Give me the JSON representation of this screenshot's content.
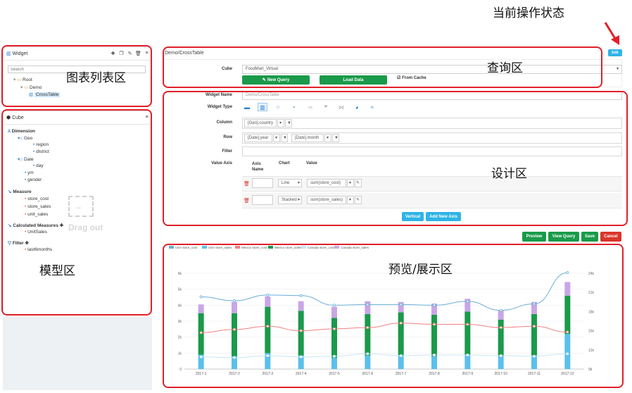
{
  "annotations": {
    "operation_status": "当前操作状态",
    "chart_list_area": "图表列表区",
    "query_area": "查询区",
    "design_area": "设计区",
    "model_area": "模型区",
    "preview_area": "预览/展示区"
  },
  "widget_panel": {
    "title": "Widget",
    "search_placeholder": "Search",
    "tree": [
      "Root",
      "Demo",
      "CrossTable"
    ]
  },
  "cube_panel": {
    "title": "Cube",
    "dimension_label": "Dimension",
    "geo": "Geo",
    "region": "region",
    "district": "district",
    "date": "Date",
    "day": "day",
    "ym": "ym",
    "gender": "gender",
    "measure_label": "Measure",
    "measures": [
      "store_cost",
      "store_sales",
      "unit_sales"
    ],
    "calculated_label": "Calculated Measures",
    "calculated": [
      "UnitSales"
    ],
    "filter_label": "Filter",
    "filters": [
      "last6months"
    ],
    "drag_hint": "Drag out"
  },
  "header": {
    "breadcrumb": "Demo/CrossTable",
    "edit_badge": "Edit"
  },
  "query": {
    "cube_label": "Cube",
    "cube_value": "FoodMart_Virtual",
    "new_query": "New Query",
    "load_data": "Load Data",
    "from_cache": "From Cache"
  },
  "design": {
    "widget_name_label": "Widget Name",
    "widget_name_value": "Demo/CrossTable",
    "widget_type_label": "Widget Type",
    "column_label": "Column",
    "column_value": "[Geo].country",
    "row_label": "Row",
    "row_value_1": "[Date].year",
    "row_value_2": "[Date].month",
    "filter_label": "Filter",
    "value_axis_label": "Value Axis",
    "axis_name_col": "Axis Name",
    "chart_col": "Chart",
    "value_col": "Value",
    "axis1_chart": "Line",
    "axis1_value": "sum(store_cost)",
    "axis2_chart": "Stacked",
    "axis2_value": "sum(store_sales)",
    "vertical_btn": "Vertical",
    "add_axis_btn": "Add New Axis"
  },
  "actions": {
    "preview": "Preview",
    "view_query": "View Query",
    "save": "Save",
    "cancel": "Cancel"
  },
  "chart_data": {
    "type": "bar",
    "categories": [
      "2017-1",
      "2017-2",
      "2017-3",
      "2017-4",
      "2017-5",
      "2017-6",
      "2017-7",
      "2017-8",
      "2017-9",
      "2017-10",
      "2017-11",
      "2017-12"
    ],
    "legend": [
      "USA store_cost",
      "USA store_sales",
      "Mexico store_cost",
      "Mexico store_sales",
      "Canada store_cost",
      "Canada store_sales"
    ],
    "left_axis": [
      "0",
      "1k",
      "2k",
      "3k",
      "4k",
      "5k",
      "6k"
    ],
    "right_axis": [
      "9k",
      "12k",
      "15k",
      "18k",
      "21k",
      "24k"
    ],
    "ylim_left": [
      0,
      6000
    ],
    "ylim_right": [
      9000,
      24000
    ],
    "series": [
      {
        "name": "USA store_sales",
        "color": "#5bc0eb",
        "values": [
          900,
          800,
          1000,
          850,
          700,
          850,
          850,
          800,
          900,
          800,
          850,
          2200
        ]
      },
      {
        "name": "Mexico store_sales",
        "color": "#1a9a4a",
        "values": [
          2600,
          2700,
          2900,
          2800,
          2500,
          2600,
          2700,
          2600,
          2700,
          2300,
          2600,
          2400
        ]
      },
      {
        "name": "Canada store_sales",
        "color": "#c9a6e6",
        "values": [
          550,
          700,
          650,
          600,
          700,
          800,
          650,
          700,
          800,
          600,
          750,
          850
        ]
      }
    ],
    "lines": [
      {
        "name": "USA store_cost",
        "color": "#6aaed6",
        "axis": "right",
        "values": [
          20300,
          19700,
          20600,
          20500,
          19000,
          19100,
          19100,
          19000,
          19600,
          18200,
          19200,
          24100
        ]
      },
      {
        "name": "Mexico store_cost",
        "color": "#f08080",
        "axis": "right",
        "values": [
          14700,
          15200,
          15700,
          15000,
          15300,
          15500,
          16200,
          16000,
          16000,
          15500,
          15700,
          14800
        ]
      },
      {
        "name": "Canada store_cost",
        "color": "#c8e6f5",
        "axis": "right",
        "values": [
          10900,
          10800,
          11100,
          10900,
          11000,
          11400,
          11100,
          11200,
          11200,
          11100,
          11000,
          11400
        ]
      }
    ]
  },
  "colors": {
    "accent_blue": "#2fb3e6",
    "accent_green": "#1a9a4a",
    "danger": "#d9342b",
    "annotation_red": "#e0202a"
  }
}
